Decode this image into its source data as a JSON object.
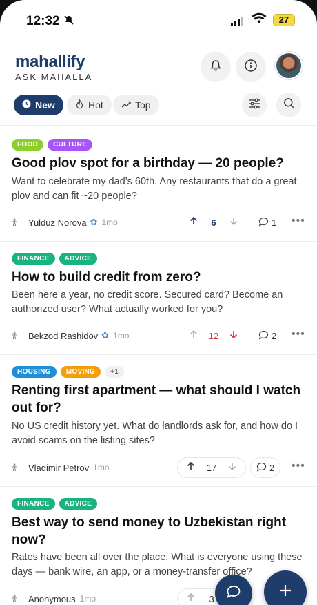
{
  "status": {
    "time": "12:32",
    "battery": "27"
  },
  "app": {
    "name": "mahallify",
    "tagline": "ASK MAHALLA"
  },
  "filters": {
    "new": "New",
    "hot": "Hot",
    "top": "Top"
  },
  "posts": [
    {
      "tags": [
        {
          "label": "FOOD",
          "color": "#8ccf2a"
        },
        {
          "label": "CULTURE",
          "color": "#a855f7"
        }
      ],
      "title": "Good plov spot for a birthday — 20 people?",
      "body": "Want to celebrate my dad’s 60th. Any restaurants that do a great plov and can fit ~20 people?",
      "author": "Yulduz Norova",
      "age": "1mo",
      "votes": "6",
      "comments": "1"
    },
    {
      "tags": [
        {
          "label": "FINANCE",
          "color": "#19b37f"
        },
        {
          "label": "ADVICE",
          "color": "#19b37f"
        }
      ],
      "title": "How to build credit from zero?",
      "body": "Been here a year, no credit score. Secured card? Become an authorized user? What actually worked for you?",
      "author": "Bekzod Rashidov",
      "age": "1mo",
      "votes": "12",
      "comments": "2"
    },
    {
      "tags": [
        {
          "label": "HOUSING",
          "color": "#1e8fd6"
        },
        {
          "label": "MOVING",
          "color": "#f59e0b"
        }
      ],
      "more": "+1",
      "title": "Renting first apartment — what should I watch out for?",
      "body": "No US credit history yet. What do landlords ask for, and how do I avoid scams on the listing sites?",
      "author": "Vladimir Petrov",
      "age": "1mo",
      "votes": "17",
      "comments": "2"
    },
    {
      "tags": [
        {
          "label": "FINANCE",
          "color": "#19b37f"
        },
        {
          "label": "ADVICE",
          "color": "#19b37f"
        }
      ],
      "title": "Best way to send money to Uzbekistan right now?",
      "body": "Rates have been all over the place. What is everyone using these days — bank wire, an app, or a money-transfer office?",
      "author": "Anonymous",
      "age": "1mo",
      "votes": "3"
    }
  ]
}
